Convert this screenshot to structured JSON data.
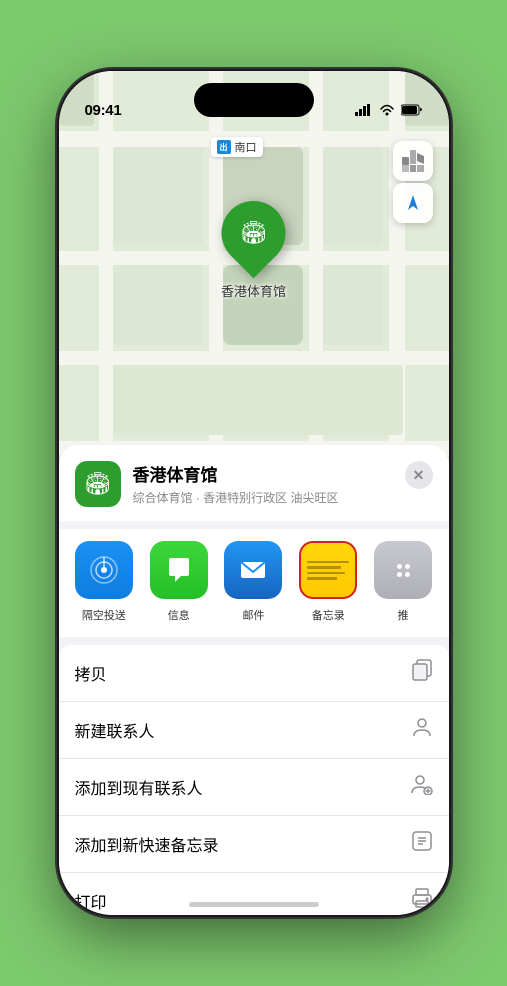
{
  "status_bar": {
    "time": "09:41",
    "location_icon": "▶",
    "signal": "●●●●",
    "wifi": "wifi",
    "battery": "battery"
  },
  "map": {
    "label_text": "南口",
    "venue_label": "香港体育馆",
    "venue_emoji": "🏟",
    "controls": {
      "map_icon": "🗺",
      "location_icon": "➤"
    }
  },
  "venue_header": {
    "name": "香港体育馆",
    "description": "综合体育馆 · 香港特别行政区 油尖旺区",
    "close_label": "✕"
  },
  "share_items": [
    {
      "id": "airdrop",
      "label": "隔空投送",
      "color": "#1c90f3",
      "emoji": "📡"
    },
    {
      "id": "message",
      "label": "信息",
      "color": "#2acf2a",
      "emoji": "💬"
    },
    {
      "id": "mail",
      "label": "邮件",
      "color": "#1c90f3",
      "emoji": "✉"
    },
    {
      "id": "notes",
      "label": "备忘录",
      "highlighted": true
    },
    {
      "id": "more",
      "label": "推"
    }
  ],
  "action_items": [
    {
      "id": "copy",
      "label": "拷贝",
      "icon": "⎘"
    },
    {
      "id": "new_contact",
      "label": "新建联系人",
      "icon": "👤"
    },
    {
      "id": "add_existing",
      "label": "添加到现有联系人",
      "icon": "👤"
    },
    {
      "id": "quick_note",
      "label": "添加到新快速备忘录",
      "icon": "⊡"
    },
    {
      "id": "print",
      "label": "打印",
      "icon": "🖨"
    }
  ]
}
